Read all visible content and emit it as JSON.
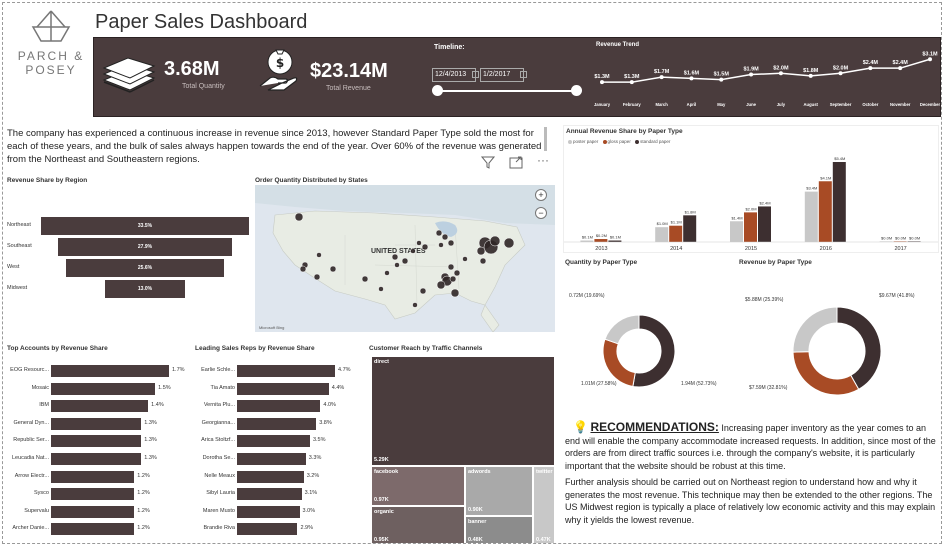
{
  "brand": {
    "line1": "PARCH &",
    "line2": "POSEY"
  },
  "title": "Paper Sales Dashboard",
  "kpis": {
    "quantity_value": "3.68M",
    "quantity_label": "Total Quantity",
    "revenue_value": "$23.14M",
    "revenue_label": "Total Revenue"
  },
  "timeline": {
    "label": "Timeline:",
    "start": "12/4/2013",
    "end": "1/2/2017"
  },
  "revenue_trend": {
    "title": "Revenue Trend",
    "months": [
      "January",
      "February",
      "March",
      "April",
      "May",
      "June",
      "July",
      "August",
      "September",
      "October",
      "November",
      "December"
    ],
    "labels": [
      "$1.3M",
      "$1.3M",
      "$1.7M",
      "$1.6M",
      "$1.5M",
      "$1.9M",
      "$2.0M",
      "$1.8M",
      "$2.0M",
      "$2.4M",
      "$2.4M",
      "$3.1M"
    ],
    "values": [
      1.3,
      1.3,
      1.7,
      1.6,
      1.5,
      1.9,
      2.0,
      1.8,
      2.0,
      2.4,
      2.4,
      3.1
    ]
  },
  "note": "The company has experienced a continuous increase in revenue since 2013, however Standard Paper Type sold the most for each of these years, and the bulk of sales always happen towards the end of the year. Over 60% of  the revenue was generated from  the Northeast and Southeastern regions.",
  "region": {
    "title": "Revenue Share by Region",
    "items": [
      {
        "name": "Northeast",
        "value": "33.5%",
        "pct": 33.5
      },
      {
        "name": "Southeast",
        "value": "27.9%",
        "pct": 27.9
      },
      {
        "name": "West",
        "value": "25.6%",
        "pct": 25.6
      },
      {
        "name": "Midwest",
        "value": "13.0%",
        "pct": 13.0
      }
    ]
  },
  "map": {
    "title": "Order Quantity Distributed by States",
    "country_label": "UNITED STATES",
    "attribution": "Microsoft Bing"
  },
  "accounts": {
    "title": "Top Accounts by Revenue Share",
    "items": [
      {
        "name": "EOG Resourc...",
        "value": "1.7%",
        "pct": 1.7
      },
      {
        "name": "Mosaic",
        "value": "1.5%",
        "pct": 1.5
      },
      {
        "name": "IBM",
        "value": "1.4%",
        "pct": 1.4
      },
      {
        "name": "General Dyn...",
        "value": "1.3%",
        "pct": 1.3
      },
      {
        "name": "Republic Ser...",
        "value": "1.3%",
        "pct": 1.3
      },
      {
        "name": "Leucadia Nat...",
        "value": "1.3%",
        "pct": 1.3
      },
      {
        "name": "Arrow Electr...",
        "value": "1.2%",
        "pct": 1.2
      },
      {
        "name": "Sysco",
        "value": "1.2%",
        "pct": 1.2
      },
      {
        "name": "Supervalu",
        "value": "1.2%",
        "pct": 1.2
      },
      {
        "name": "Archer Danie...",
        "value": "1.2%",
        "pct": 1.2
      }
    ]
  },
  "reps": {
    "title": "Leading Sales Reps by Revenue Share",
    "items": [
      {
        "name": "Earlie Schle...",
        "value": "4.7%",
        "pct": 4.7
      },
      {
        "name": "Tia Amato",
        "value": "4.4%",
        "pct": 4.4
      },
      {
        "name": "Vernita Plu...",
        "value": "4.0%",
        "pct": 4.0
      },
      {
        "name": "Georgianna...",
        "value": "3.8%",
        "pct": 3.8
      },
      {
        "name": "Arica Stoltzf...",
        "value": "3.5%",
        "pct": 3.5
      },
      {
        "name": "Dorotha Se...",
        "value": "3.3%",
        "pct": 3.3
      },
      {
        "name": "Nelle Meaux",
        "value": "3.2%",
        "pct": 3.2
      },
      {
        "name": "Sibyl Lauria",
        "value": "3.1%",
        "pct": 3.1
      },
      {
        "name": "Maren Musto",
        "value": "3.0%",
        "pct": 3.0
      },
      {
        "name": "Brandie Riva",
        "value": "2.9%",
        "pct": 2.9
      }
    ]
  },
  "traffic": {
    "title": "Customer Reach by Traffic Channels",
    "tiles": [
      {
        "name": "direct",
        "value": "5.29K"
      },
      {
        "name": "facebook",
        "value": "0.97K"
      },
      {
        "name": "adwords",
        "value": "0.90K"
      },
      {
        "name": "twitter",
        "value": "0.47K"
      },
      {
        "name": "organic",
        "value": "0.95K"
      },
      {
        "name": "banner",
        "value": "0.48K"
      }
    ]
  },
  "annual": {
    "title": "Annual Revenue Share by Paper Type",
    "legend": [
      "poster paper",
      "gloss paper",
      "standard paper"
    ],
    "colors": {
      "poster": "#c8c8c8",
      "gloss": "#a84b25",
      "standard": "#3d2f30"
    },
    "years": [
      "2013",
      "2014",
      "2015",
      "2016",
      "2017"
    ],
    "poster": [
      0.1,
      1.0,
      1.4,
      3.4,
      0.0
    ],
    "poster_labels": [
      "$0.1M",
      "$1.0M",
      "$1.4M",
      "$3.4M",
      "$0.0M"
    ],
    "gloss": [
      0.2,
      1.1,
      2.0,
      4.1,
      0.0
    ],
    "gloss_labels": [
      "$0.2M",
      "$1.1M",
      "$2.0M",
      "$4.1M",
      "$0.0M"
    ],
    "standard": [
      0.1,
      1.8,
      2.4,
      5.4,
      0.0
    ],
    "standard_labels": [
      "$0.1M",
      "$1.8M",
      "$2.4M",
      "$5.4M",
      "$0.0M"
    ]
  },
  "quantity_donut": {
    "title": "Quantity by Paper Type",
    "slices": [
      {
        "name": "standard",
        "pct": 52.73,
        "label": "1.94M (52.73%)"
      },
      {
        "name": "gloss",
        "pct": 27.58,
        "label": "1.01M (27.58%)"
      },
      {
        "name": "poster",
        "pct": 19.69,
        "label": "0.72M (19.69%)"
      }
    ]
  },
  "revenue_donut": {
    "title": "Revenue by Paper Type",
    "slices": [
      {
        "name": "standard",
        "pct": 41.8,
        "label": "$9.67M (41.8%)"
      },
      {
        "name": "gloss",
        "pct": 32.81,
        "label": "$7.59M (32.81%)"
      },
      {
        "name": "poster",
        "pct": 25.39,
        "label": "$5.88M (25.39%)"
      }
    ]
  },
  "recommendations": {
    "heading": "RECOMMENDATIONS:",
    "p1": "Increasing paper inventory as the year comes to an end  will enable the company accommodate increased requests. In addition, since most of the orders are from direct traffic sources i.e. through the company's website, it is particularly important that the website should be robust at this time.",
    "p2": "Further analysis should be carried out on Northeast region to understand how and why it generates the most revenue. This technique may then be extended to the other regions. The US Midwest region is typically a place of relatively low economic activity and this may explain why it yields the lowest revenue."
  },
  "chart_data": [
    {
      "type": "line",
      "title": "Revenue Trend",
      "x": [
        "January",
        "February",
        "March",
        "April",
        "May",
        "June",
        "July",
        "August",
        "September",
        "October",
        "November",
        "December"
      ],
      "series": [
        {
          "values": [
            1.3,
            1.3,
            1.7,
            1.6,
            1.5,
            1.9,
            2.0,
            1.8,
            2.0,
            2.4,
            2.4,
            3.1
          ]
        }
      ]
    },
    {
      "type": "bar",
      "title": "Revenue Share by Region",
      "categories": [
        "Northeast",
        "Southeast",
        "West",
        "Midwest"
      ],
      "values": [
        33.5,
        27.9,
        25.6,
        13.0
      ]
    },
    {
      "type": "bar",
      "title": "Annual Revenue Share by Paper Type",
      "categories": [
        "2013",
        "2014",
        "2015",
        "2016",
        "2017"
      ],
      "series": [
        {
          "name": "poster paper",
          "values": [
            0.1,
            1.0,
            1.4,
            3.4,
            0.0
          ]
        },
        {
          "name": "gloss paper",
          "values": [
            0.2,
            1.1,
            2.0,
            4.1,
            0.0
          ]
        },
        {
          "name": "standard paper",
          "values": [
            0.1,
            1.8,
            2.4,
            5.4,
            0.0
          ]
        }
      ]
    },
    {
      "type": "pie",
      "title": "Quantity by Paper Type",
      "values": [
        52.73,
        27.58,
        19.69
      ]
    },
    {
      "type": "pie",
      "title": "Revenue by Paper Type",
      "values": [
        41.8,
        32.81,
        25.39
      ]
    }
  ]
}
